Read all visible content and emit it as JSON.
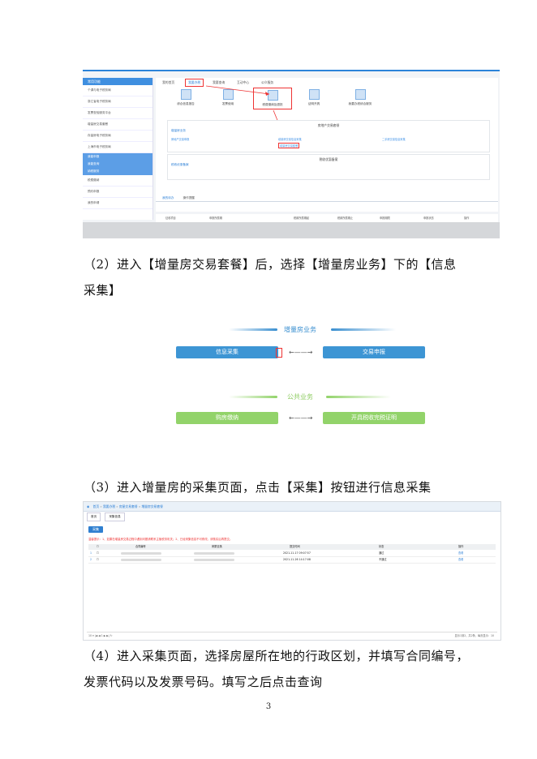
{
  "shot1": {
    "sidebar_header": "常用功能",
    "sidebar_items": [
      "个调与电子税务局",
      "浙江省电子税务局",
      "发票查验服务平台",
      "增量房交易套餐",
      "存量房电子税务局",
      "上海市电子税务局"
    ],
    "sidebar_sections": [
      "我能申报",
      "我能查询",
      "纳税服务"
    ],
    "sidebar_items2": [
      "税费缴纳",
      "预约申报",
      "我的申请"
    ],
    "tabs": [
      "我的首页",
      "我要办税",
      "我要查询",
      "互动中心",
      "公众服务"
    ],
    "tiles": [
      "综合信息报告",
      "发票使用",
      "税费缴纳及退抵",
      "证明开具",
      "我要办税综合服务"
    ],
    "panel1_title": "房地产交易套餐",
    "panel1_subtitle": "增量房业务",
    "panel1_links": [
      "房地产交易申报",
      "增量房交易信息采集",
      "二手房交易信息采集",
      "增量房交易套餐"
    ],
    "panel2_title": "税收优惠备案",
    "panel2_subtitle": "税收优惠备案",
    "bottom_tabs": [
      "我的待办",
      "操作提醒"
    ],
    "table_headers": [
      "征收项目",
      "申报所属期",
      "税款所属期起",
      "税款所属期止",
      "申报期限",
      "申报状态",
      "操作"
    ]
  },
  "para2": "（2）进入【增量房交易套餐】后，选择【增量房业务】下的【信息",
  "para2b": "采集】",
  "shot2": {
    "section1_title": "增量房业务",
    "btn_collect": "信息采集",
    "btn_declare": "交易申报",
    "section2_title": "公共业务",
    "btn_tax": "购房缴纳",
    "btn_upload": "开具税收完税证明",
    "arrow": "←——→"
  },
  "para3": "（3）进入增量房的采集页面，点击【采集】按钮进行信息采集",
  "shot3": {
    "crumbs": [
      "首页",
      "我要办税",
      "房屋交易套餐",
      "增量房交易套餐"
    ],
    "tabs": [
      "首页",
      "采集信息"
    ],
    "collect_label": "采集",
    "notice": "温馨提示：1、如果在增量房交易过程中遇到问题请联系主管税务机关；2、已经采集信息不可修改，请核实后再提交。",
    "headers": [
      "合同编号",
      "房屋坐落",
      "提交时间",
      "状态",
      "操作"
    ],
    "rows": [
      {
        "time": "2021-11-17 09:07:57",
        "status": "通过",
        "op": "查看"
      },
      {
        "time": "2021-11-26 14:17:08",
        "status": "不通过",
        "op": "查看"
      }
    ],
    "pager_right": "显示1到2，共2条，每页显示：10",
    "pager_left": "10 ▾  |◀ ◀  1  ▶ ▶|  ↻"
  },
  "para4": "（4）进入采集页面，选择房屋所在地的行政区划，并填写合同编号，",
  "para4b": "发票代码以及发票号码。填写之后点击查询",
  "page_number": "3",
  "colors": {
    "blue": "#3d95d4",
    "green": "#92d36a",
    "red": "#e33333"
  }
}
